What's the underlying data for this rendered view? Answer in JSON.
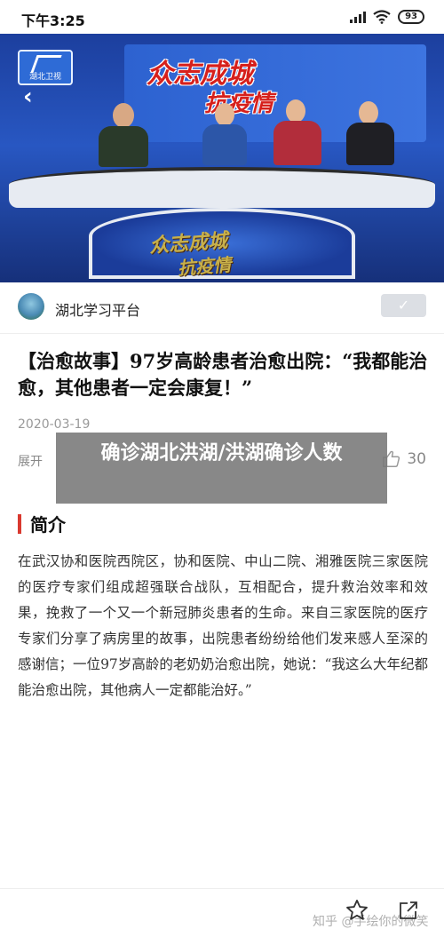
{
  "status_bar": {
    "time": "下午3:25",
    "battery": "93"
  },
  "video": {
    "channel_logo_text": "湖北卫视",
    "banner_line1": "众志成城",
    "banner_line2": "抗疫情",
    "desk_line1": "众志成城",
    "desk_line2": "抗疫情"
  },
  "author": {
    "name": "湖北学习平台",
    "follow_symbol": "✓"
  },
  "article": {
    "title": "【治愈故事】97岁高龄患者治愈出院：“我都能治愈，其他患者一定会康复！”",
    "date": "2020-03-19",
    "expand_label": "展开",
    "like_count": "30"
  },
  "overlay": {
    "text": "确诊湖北洪湖/洪湖确诊人数"
  },
  "section": {
    "title": "简介",
    "body": "在武汉协和医院西院区，协和医院、中山二院、湘雅医院三家医院的医疗专家们组成超强联合战队，互相配合，提升救治效率和效果，挽救了一个又一个新冠肺炎患者的生命。来自三家医院的医疗专家们分享了病房里的故事，出院患者纷纷给他们发来感人至深的感谢信；一位97岁高龄的老奶奶治愈出院，她说：“我这么大年纪都能治愈出院，其他病人一定都能治好。”"
  },
  "bottom": {
    "watermark": "知乎 @手绘你的微笑"
  },
  "colors": {
    "accent_red": "#d9392f",
    "video_blue": "#2857c2"
  },
  "icons": [
    "wifi-icon",
    "signal-icon",
    "battery-icon",
    "back-arrow-icon",
    "check-icon",
    "thumbs-up-icon",
    "star-icon",
    "share-icon"
  ]
}
